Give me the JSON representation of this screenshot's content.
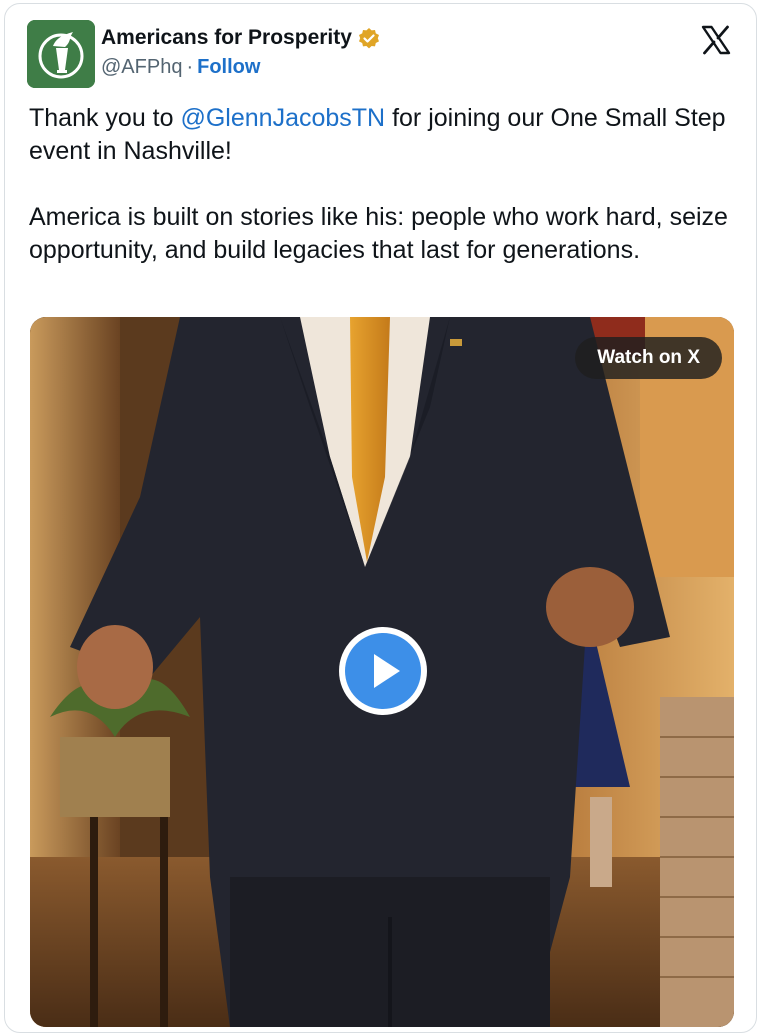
{
  "author": {
    "display_name": "Americans for Prosperity",
    "handle": "@AFPhq",
    "separator": "·",
    "follow_label": "Follow",
    "verified": true,
    "avatar_icon": "torch-logo-icon",
    "verified_icon": "verified-badge-icon"
  },
  "platform": {
    "logo_icon": "x-logo-icon"
  },
  "tweet": {
    "p1_before": "Thank you to ",
    "mention": "@GlennJacobsTN",
    "p1_after": " for joining our One Small Step event in Nashville!",
    "p2": "America is built on stories like his: people who work hard, seize opportunity, and build legacies that last for generations."
  },
  "media": {
    "watch_label": "Watch on X",
    "play_icon": "play-icon"
  },
  "colors": {
    "link": "#1d70c9",
    "text": "#0f1419",
    "secondary": "#536471",
    "avatar_bg": "#3f7d47",
    "verified": "#e0a526",
    "play": "#3d8fe8"
  }
}
